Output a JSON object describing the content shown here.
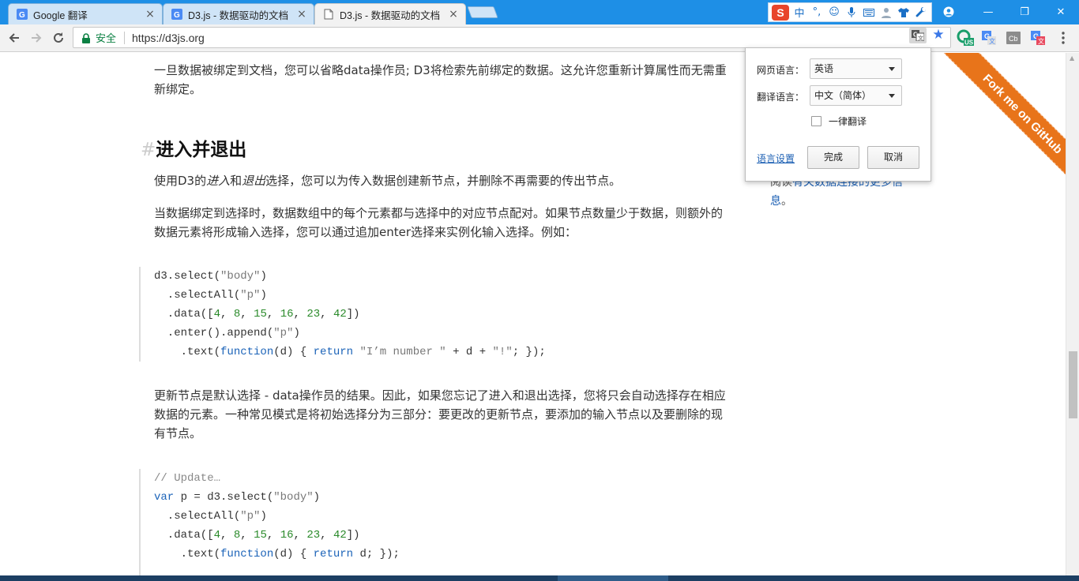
{
  "tabs": [
    {
      "title": "Google 翻译",
      "close": "×"
    },
    {
      "title": "D3.js - 数据驱动的文档",
      "close": "×"
    },
    {
      "title": "D3.js - 数据驱动的文档",
      "close": "×"
    }
  ],
  "ime": {
    "logo": "S",
    "mode": "中",
    "punct": "°,"
  },
  "window": {
    "minimize": "—",
    "maximize": "❐",
    "close": "✕"
  },
  "omnibox": {
    "secure_label": "安全",
    "url": "https://d3js.org"
  },
  "content": {
    "para1": "一旦数据被绑定到文档，您可以省略data操作员; D3将检索先前绑定的数据。这允许您重新计算属性而无需重新绑定。",
    "heading_hash": "#",
    "heading": "进入并退出",
    "para2_a": "使用D3的",
    "para2_enter": "进入",
    "para2_and": "和",
    "para2_exit": "退出",
    "para2_b": "选择，您可以为传入数据创建新节点，并删除不再需要的传出节点。",
    "para3": "当数据绑定到选择时，数据数组中的每个元素都与选择中的对应节点配对。如果节点数量少于数据，则额外的数据元素将形成输入选择，您可以通过追加enter选择来实例化输入选择。例如：",
    "para4": "更新节点是默认选择 - data操作员的结果。因此，如果您忘记了进入和退出选择，您将只会自动选择存在相应数据的元素。一种常见模式是将初始选择分为三部分：要更改的更新节点，要添加的输入节点以及要删除的现有节点。",
    "side_prefix": "阅读",
    "side_link": "有关数据连接的更多信息",
    "side_suffix": "。",
    "ribbon": "Fork me on GitHub"
  },
  "code1": {
    "l1_a": "d3.select(",
    "l1_s": "\"body\"",
    "l1_b": ")",
    "l2_a": "  .selectAll(",
    "l2_s": "\"p\"",
    "l2_b": ")",
    "l3_a": "  .data([",
    "l3_n1": "4",
    "l3_c1": ", ",
    "l3_n2": "8",
    "l3_c2": ", ",
    "l3_n3": "15",
    "l3_c3": ", ",
    "l3_n4": "16",
    "l3_c4": ", ",
    "l3_n5": "23",
    "l3_c5": ", ",
    "l3_n6": "42",
    "l3_b": "])",
    "l4_a": "  .enter().append(",
    "l4_s": "\"p\"",
    "l4_b": ")",
    "l5_a": "    .text(",
    "l5_k1": "function",
    "l5_b": "(d) { ",
    "l5_k2": "return",
    "l5_c": " ",
    "l5_s1": "\"I’m number \"",
    "l5_d": " + d + ",
    "l5_s2": "\"!\"",
    "l5_e": "; });"
  },
  "code2": {
    "l1": "// Update…",
    "l2_k": "var",
    "l2_a": " p = d3.select(",
    "l2_s": "\"body\"",
    "l2_b": ")",
    "l3_a": "  .selectAll(",
    "l3_s": "\"p\"",
    "l3_b": ")",
    "l4_a": "  .data([",
    "l4_n1": "4",
    "l4_c1": ", ",
    "l4_n2": "8",
    "l4_c2": ", ",
    "l4_n3": "15",
    "l4_c3": ", ",
    "l4_n4": "16",
    "l4_c4": ", ",
    "l4_n5": "23",
    "l4_c5": ", ",
    "l4_n6": "42",
    "l4_b": "])",
    "l5_a": "    .text(",
    "l5_k1": "function",
    "l5_b": "(d) { ",
    "l5_k2": "return",
    "l5_c": " d; });"
  },
  "translate_popup": {
    "page_lang_label": "网页语言：",
    "page_lang_value": "英语",
    "target_lang_label": "翻译语言：",
    "target_lang_value": "中文（简体）",
    "always_translate_label": "一律翻译",
    "always_translate_checked": false,
    "settings_link": "语言设置",
    "done_button": "完成",
    "cancel_button": "取消"
  },
  "colors": {
    "titlebar": "#1e8fe6",
    "accent_link": "#1b5fb3",
    "ribbon": "#e8741a",
    "secure": "#0b8043"
  }
}
